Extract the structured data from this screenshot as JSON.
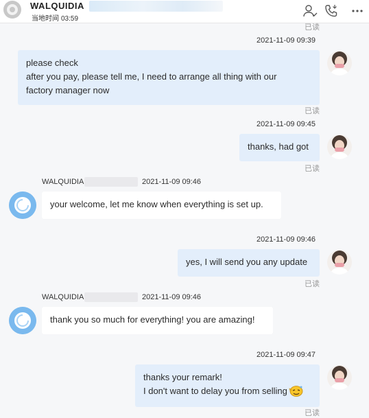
{
  "header": {
    "contact_name": "WALQUIDIA",
    "local_time_label": "当地时间",
    "local_time_value": "03:59",
    "icons": [
      "contact-icon",
      "phone-icon",
      "more-icon"
    ]
  },
  "read_label": "已读",
  "messages": [
    {
      "direction": "out",
      "timestamp": "2021-11-09 09:39",
      "lines": [
        "please check",
        "after you pay, please tell me, I need to arrange all thing with our",
        "factory manager now"
      ],
      "status": "已读"
    },
    {
      "direction": "out",
      "timestamp": "2021-11-09 09:45",
      "lines": [
        "thanks, had got"
      ],
      "status": "已读"
    },
    {
      "direction": "in",
      "sender": "WALQUIDIA",
      "timestamp": "2021-11-09 09:46",
      "lines": [
        "your welcome, let me know when everything is set up."
      ]
    },
    {
      "direction": "out",
      "timestamp": "2021-11-09 09:46",
      "lines": [
        "yes, I will send you any update"
      ],
      "status": "已读"
    },
    {
      "direction": "in",
      "sender": "WALQUIDIA",
      "timestamp": "2021-11-09 09:46",
      "lines": [
        "thank you so much for everything! you are amazing!"
      ]
    },
    {
      "direction": "out",
      "timestamp": "2021-11-09 09:47",
      "lines": [
        "thanks your remark!",
        "I don't want to delay you from selling"
      ],
      "emoji": "sweat-smile-emoji",
      "status": "已读"
    }
  ],
  "colors": {
    "outgoing_bubble": "#e3eefb",
    "incoming_bubble": "#ffffff",
    "incoming_avatar": "#7ab9ee",
    "background": "#f6f7f9"
  }
}
